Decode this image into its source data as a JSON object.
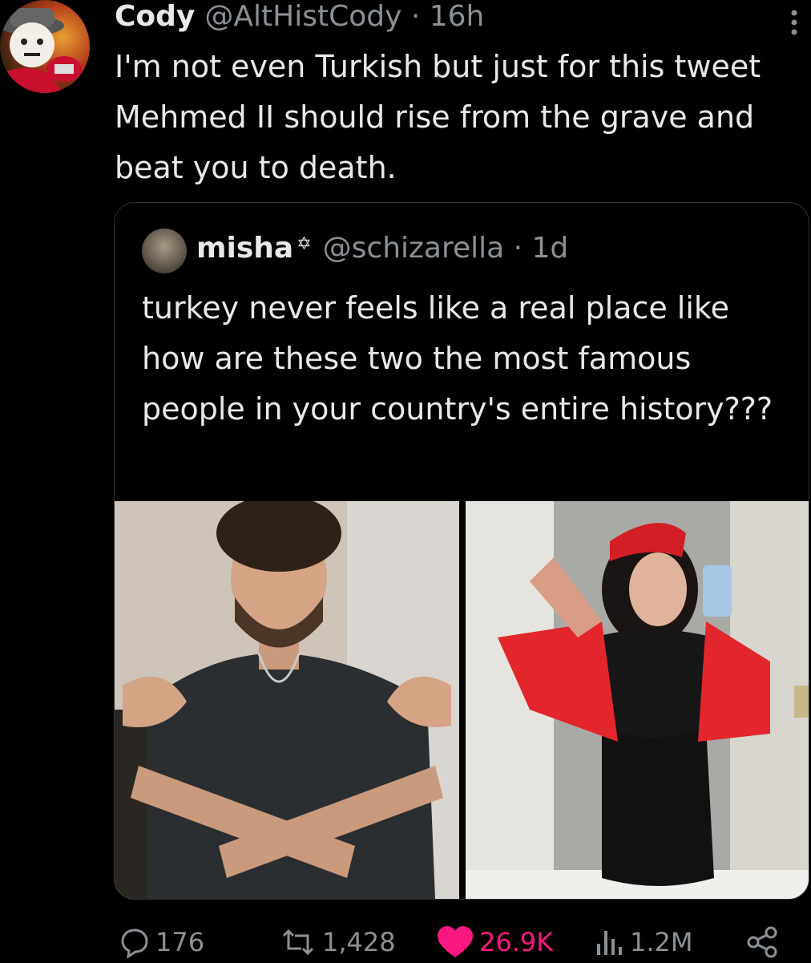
{
  "tweet": {
    "author_name": "Cody",
    "author_handle": "@AltHistCody",
    "time": "16h",
    "text": "I'm not even Turkish but just for this tweet Mehmed II should rise from the grave and beat you to death."
  },
  "quoted": {
    "author_name": "misha",
    "badge": "✡",
    "author_handle": "@schizarella",
    "time": "1d",
    "text": "turkey never feels like a real place like how are these two the most famous people in your country's entire history???"
  },
  "actions": {
    "replies": "176",
    "retweets": "1,428",
    "likes": "26.9K",
    "views": "1.2M"
  },
  "colors": {
    "background": "#000000",
    "text": "#e7e9ea",
    "muted": "#8b9095",
    "like": "#f91880"
  }
}
